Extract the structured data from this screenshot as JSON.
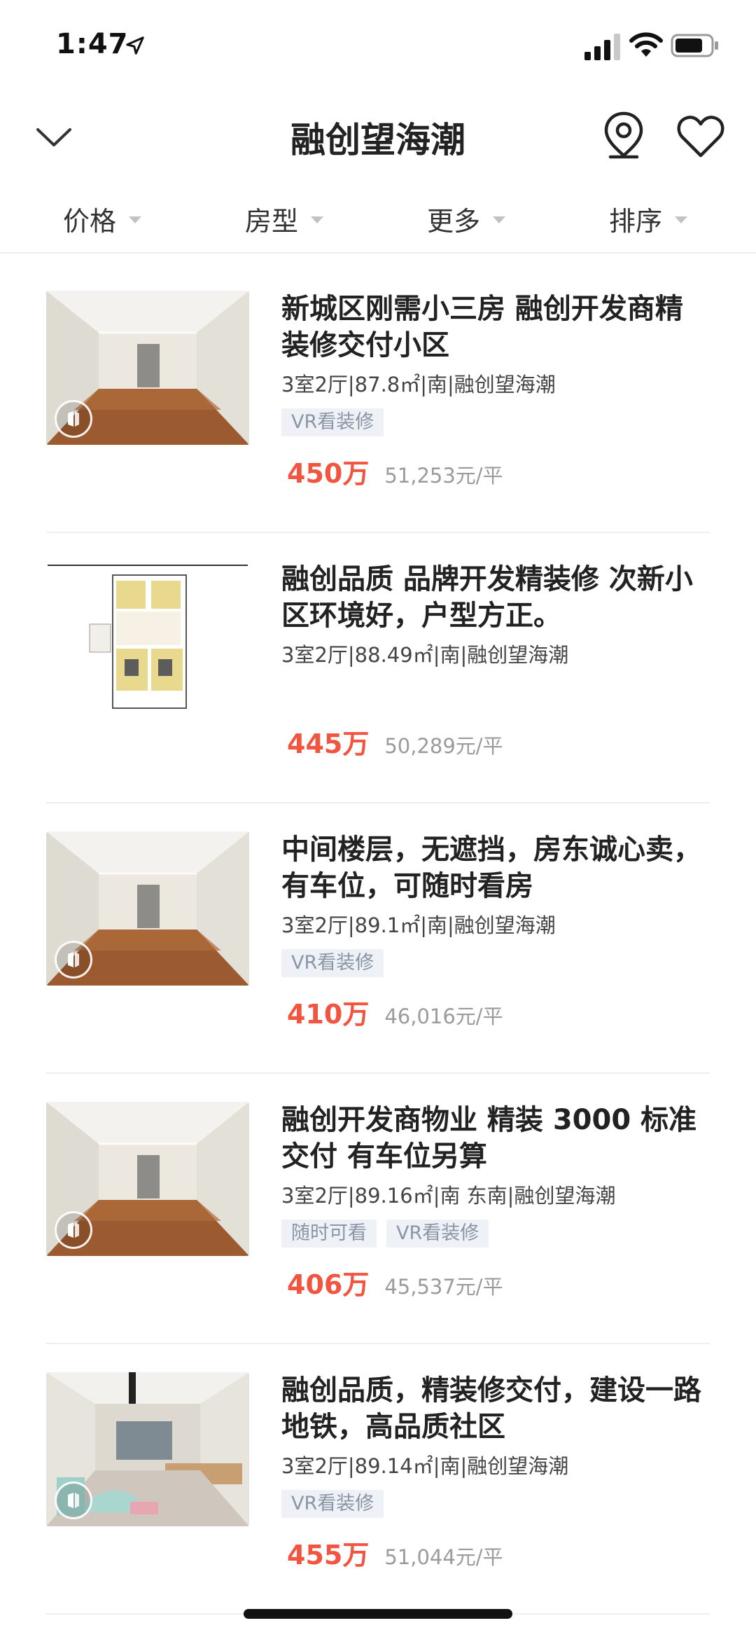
{
  "status": {
    "time": "1:47"
  },
  "header": {
    "title": "融创望海潮"
  },
  "filters": [
    {
      "label": "价格"
    },
    {
      "label": "房型"
    },
    {
      "label": "更多"
    },
    {
      "label": "排序"
    }
  ],
  "listings": [
    {
      "title": "新城区刚需小三房 融创开发商精装修交付小区",
      "meta": "3室2厅|87.8㎡|南|融创望海潮",
      "tags": [
        "VR看装修"
      ],
      "price": "450万",
      "unit_price": "51,253元/平",
      "photo": "room",
      "vr": true
    },
    {
      "title": "融创品质 品牌开发精装修 次新小区环境好，户型方正。",
      "meta": "3室2厅|88.49㎡|南|融创望海潮",
      "tags": [],
      "price": "445万",
      "unit_price": "50,289元/平",
      "photo": "floorplan",
      "vr": false
    },
    {
      "title": "中间楼层，无遮挡，房东诚心卖，有车位，可随时看房",
      "meta": "3室2厅|89.1㎡|南|融创望海潮",
      "tags": [
        "VR看装修"
      ],
      "price": "410万",
      "unit_price": "46,016元/平",
      "photo": "room",
      "vr": true
    },
    {
      "title": "融创开发商物业 精装 3000 标准交付 有车位另算",
      "meta": "3室2厅|89.16㎡|南 东南|融创望海潮",
      "tags": [
        "随时可看",
        "VR看装修"
      ],
      "price": "406万",
      "unit_price": "45,537元/平",
      "photo": "room",
      "vr": true
    },
    {
      "title": "融创品质，精装修交付，建设一路地铁，高品质社区",
      "meta": "3室2厅|89.14㎡|南|融创望海潮",
      "tags": [
        "VR看装修"
      ],
      "price": "455万",
      "unit_price": "51,044元/平",
      "photo": "kidsroom",
      "vr": true
    }
  ],
  "colors": {
    "price": "#f1553f",
    "tag_text": "#8a95a5",
    "tag_bg": "#eef1f5",
    "divider": "#eeeeee"
  },
  "icons": [
    "location-arrow-icon",
    "cellular-signal-icon",
    "wifi-icon",
    "battery-icon",
    "chevron-down-icon",
    "map-pin-icon",
    "heart-icon",
    "vr-icon"
  ]
}
